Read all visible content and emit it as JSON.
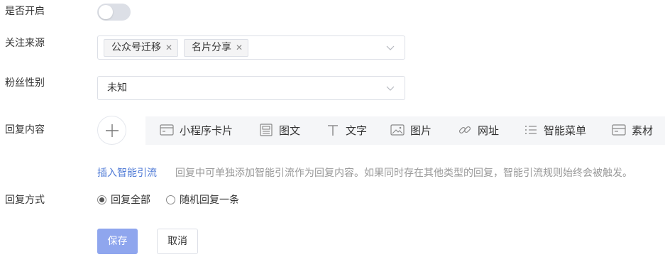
{
  "form": {
    "enable": {
      "label": "是否开启",
      "value": false
    },
    "source": {
      "label": "关注来源",
      "tags": [
        "公众号迁移",
        "名片分享"
      ]
    },
    "gender": {
      "label": "粉丝性别",
      "value": "未知"
    },
    "reply_content": {
      "label": "回复内容",
      "toolbar": [
        {
          "label": "小程序卡片",
          "icon": "card-icon"
        },
        {
          "label": "图文",
          "icon": "article-icon"
        },
        {
          "label": "文字",
          "icon": "text-icon"
        },
        {
          "label": "图片",
          "icon": "image-icon"
        },
        {
          "label": "网址",
          "icon": "link-icon"
        },
        {
          "label": "智能菜单",
          "icon": "menu-list-icon"
        },
        {
          "label": "素材",
          "icon": "material-icon"
        }
      ],
      "insert_link": "插入智能引流",
      "hint": "回复中可单独添加智能引流作为回复内容。如果同时存在其他类型的回复，智能引流规则始终会被触发。"
    },
    "reply_mode": {
      "label": "回复方式",
      "options": [
        {
          "label": "回复全部",
          "selected": true
        },
        {
          "label": "随机回复一条",
          "selected": false
        }
      ]
    },
    "actions": {
      "save": "保存",
      "cancel": "取消"
    }
  },
  "colors": {
    "primary_button": "#8fa6ee",
    "link": "#4f7ad6",
    "toggle_off": "#dcdfe6",
    "toolbar_bg": "#f5f6f8"
  }
}
